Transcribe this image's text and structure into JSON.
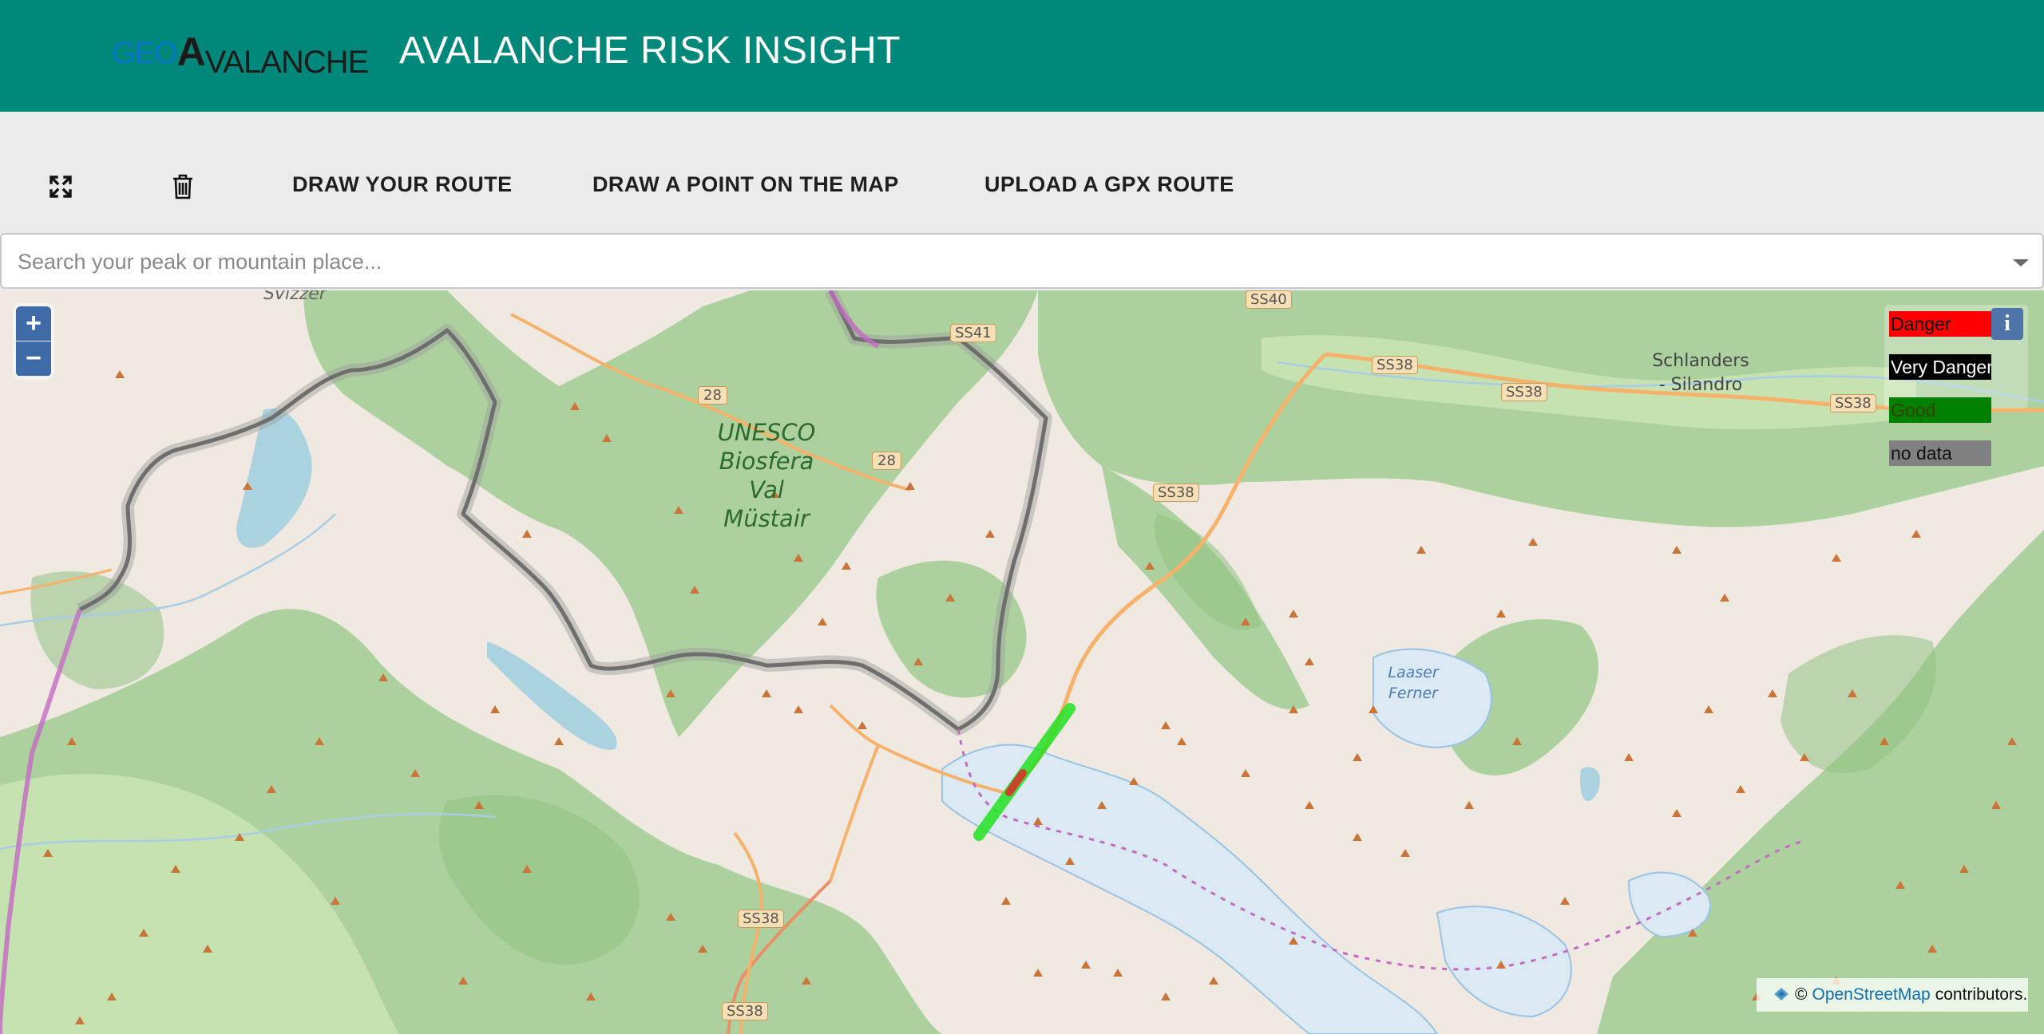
{
  "header": {
    "logo": {
      "geo": "GEO",
      "a": "A",
      "rest": "VALANCHE"
    },
    "title": "AVALANCHE RISK INSIGHT"
  },
  "toolbar": {
    "fullscreen_icon": "fullscreen-icon",
    "trash_icon": "trash-icon",
    "draw_route_label": "DRAW YOUR ROUTE",
    "draw_point_label": "DRAW A POINT ON THE MAP",
    "upload_gpx_label": "UPLOAD A GPX ROUTE"
  },
  "search": {
    "placeholder": "Search your peak or mountain place...",
    "value": ""
  },
  "map": {
    "zoom_in": "+",
    "zoom_out": "−",
    "place_labels": {
      "unesco_line1": "UNESCO",
      "unesco_line2": "Biosfera",
      "unesco_line3": "Val Müstair",
      "schlanders_line1": "Schlanders",
      "schlanders_line2": "- Silandro",
      "laaser_line1": "Laaser",
      "laaser_line2": "Ferner",
      "svizzer": "Svizzer"
    },
    "road_labels": {
      "ss40": "SS40",
      "ss41": "SS41",
      "r28a": "28",
      "r28b": "28",
      "ss38a": "SS38",
      "ss38b": "SS38",
      "ss38c": "SS38",
      "ss38d": "SS38",
      "ss38e": "SS38",
      "ss38f": "SS38"
    },
    "colors": {
      "land": "#efe9e1",
      "forest": "#add19e",
      "forest_dark": "#8fc383",
      "border": "#8a8a8a",
      "route_good": "#22e022",
      "route_danger": "#e02a2a"
    }
  },
  "legend": {
    "info": "i",
    "items": [
      {
        "label": "Danger",
        "bg": "#ff0000",
        "fg": "#111111"
      },
      {
        "label": "Very Danger",
        "bg": "#000000",
        "fg": "#ffffff"
      },
      {
        "label": "Good",
        "bg": "#008000",
        "fg": "#3d3d00"
      },
      {
        "label": "no data",
        "bg": "#808080",
        "fg": "#111111"
      }
    ]
  },
  "attribution": {
    "copyright": "©",
    "link": "OpenStreetMap",
    "suffix": "contributors."
  }
}
